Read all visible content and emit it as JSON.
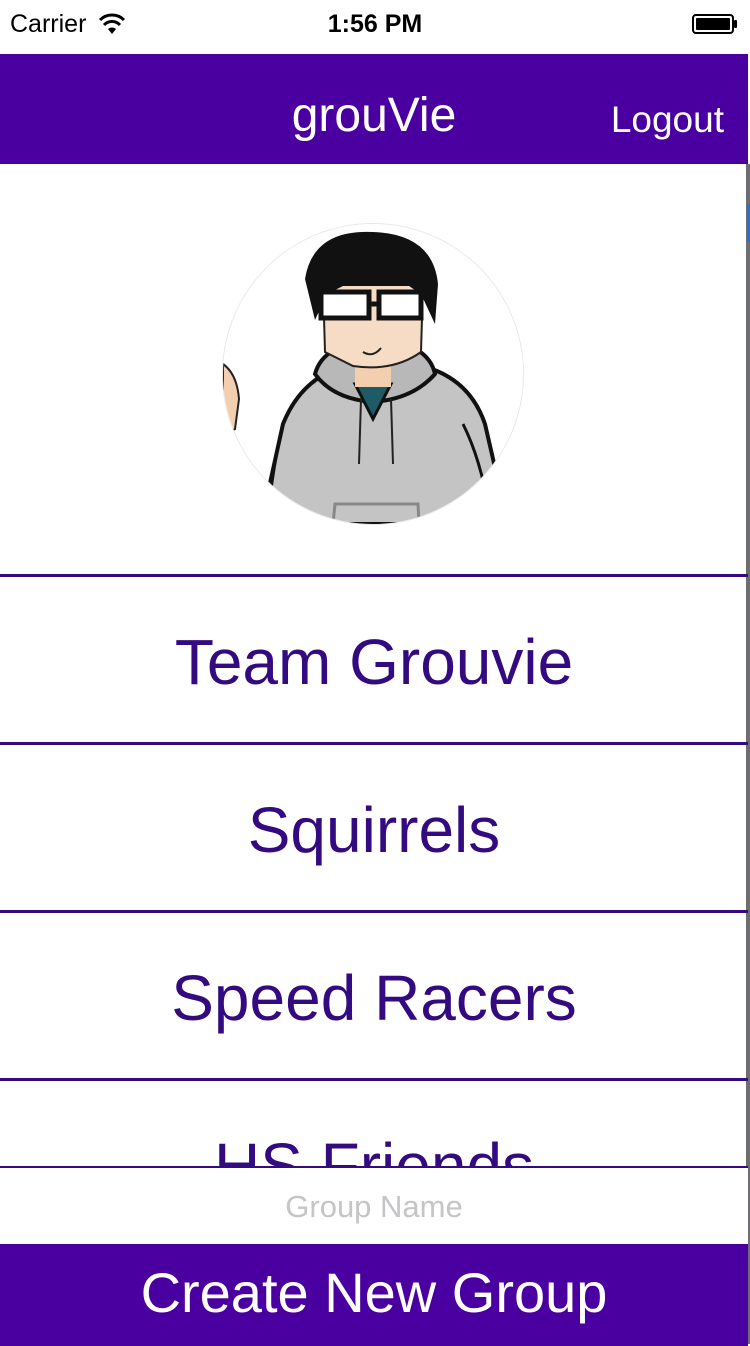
{
  "status_bar": {
    "carrier": "Carrier",
    "time": "1:56 PM",
    "icons": [
      "wifi-icon",
      "battery-icon"
    ]
  },
  "nav": {
    "title": "grouVie",
    "logout_label": "Logout"
  },
  "profile": {
    "avatar": "cartoon-avatar-with-glasses-and-gray-hoodie"
  },
  "groups": [
    {
      "label": "Team Grouvie"
    },
    {
      "label": "Squirrels"
    },
    {
      "label": "Speed Racers"
    },
    {
      "label": "HS Friends"
    }
  ],
  "create_group": {
    "input_value": "",
    "input_placeholder": "Group Name",
    "button_label": "Create New Group"
  },
  "colors": {
    "brand_purple": "#4a00a0",
    "list_text": "#330a80",
    "divider": "#330a80",
    "placeholder": "#c5c5c7"
  }
}
